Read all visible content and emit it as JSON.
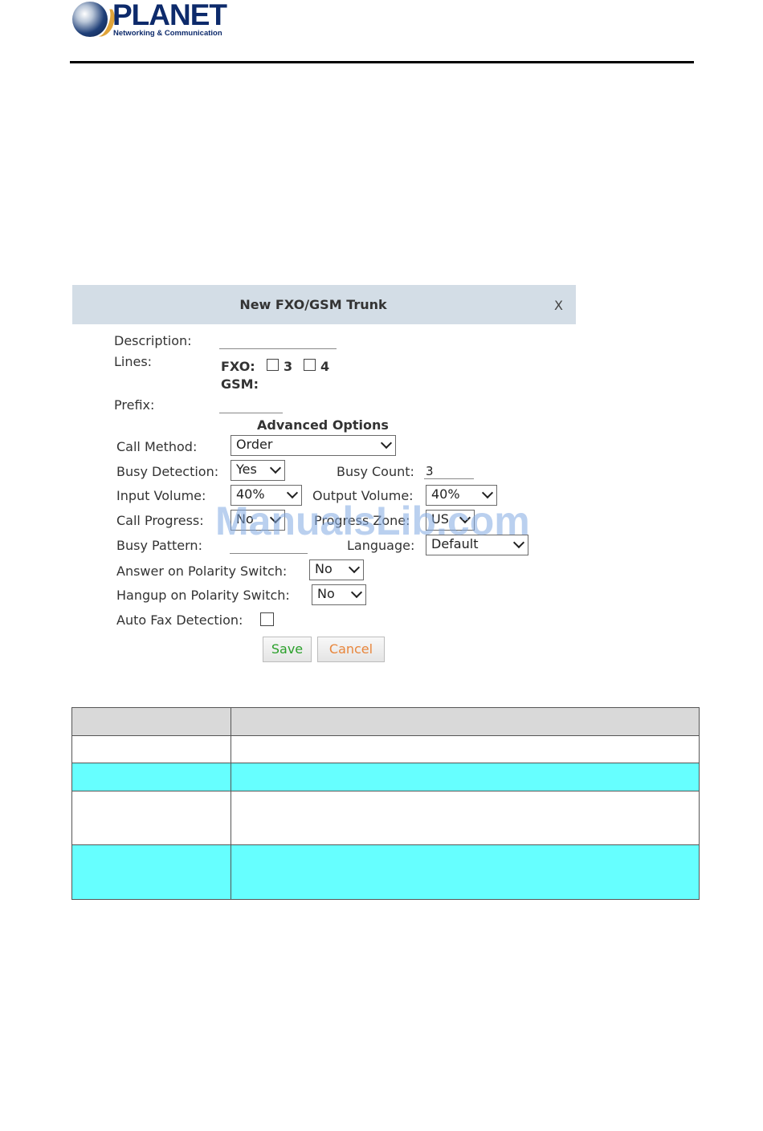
{
  "header": {
    "brand_name": "PLANET",
    "brand_tagline": "Networking & Communication"
  },
  "dialog": {
    "title": "New FXO/GSM Trunk",
    "close_label": "X",
    "description_label": "Description:",
    "description_value": "",
    "lines_label": "Lines:",
    "fxo_label": "FXO:",
    "fxo_ports": [
      "3",
      "4"
    ],
    "gsm_label": "GSM:",
    "prefix_label": "Prefix:",
    "prefix_value": "",
    "advanced_title": "Advanced Options",
    "call_method_label": "Call Method:",
    "call_method_value": "Order",
    "busy_detection_label": "Busy Detection:",
    "busy_detection_value": "Yes",
    "busy_count_label": "Busy Count:",
    "busy_count_value": "3",
    "input_volume_label": "Input Volume:",
    "input_volume_value": "40%",
    "output_volume_label": "Output Volume:",
    "output_volume_value": "40%",
    "call_progress_label": "Call Progress:",
    "call_progress_value": "No",
    "progress_zone_label": "Progress Zone:",
    "progress_zone_value": "US",
    "busy_pattern_label": "Busy Pattern:",
    "busy_pattern_value": "",
    "language_label": "Language:",
    "language_value": "Default",
    "answer_polarity_label": "Answer on Polarity Switch:",
    "answer_polarity_value": "No",
    "hangup_polarity_label": "Hangup on Polarity Switch:",
    "hangup_polarity_value": "No",
    "auto_fax_label": "Auto Fax Detection:",
    "save_label": "Save",
    "cancel_label": "Cancel"
  },
  "watermark": "ManualsLib.com",
  "table": {
    "rows": [
      {
        "style": "head",
        "c1": "",
        "c2": ""
      },
      {
        "style": "white",
        "c1": "",
        "c2": ""
      },
      {
        "style": "cyan",
        "c1": "",
        "c2": ""
      },
      {
        "style": "white",
        "c1": "",
        "c2": ""
      },
      {
        "style": "cyan",
        "c1": "",
        "c2": ""
      }
    ]
  },
  "colors": {
    "dialog_bar": "#d3dde6",
    "table_header": "#d9d9d9",
    "table_cyan": "#66ffff",
    "save_text": "#2aa02a",
    "cancel_text": "#e8863c",
    "brand": "#0d2a6b"
  }
}
